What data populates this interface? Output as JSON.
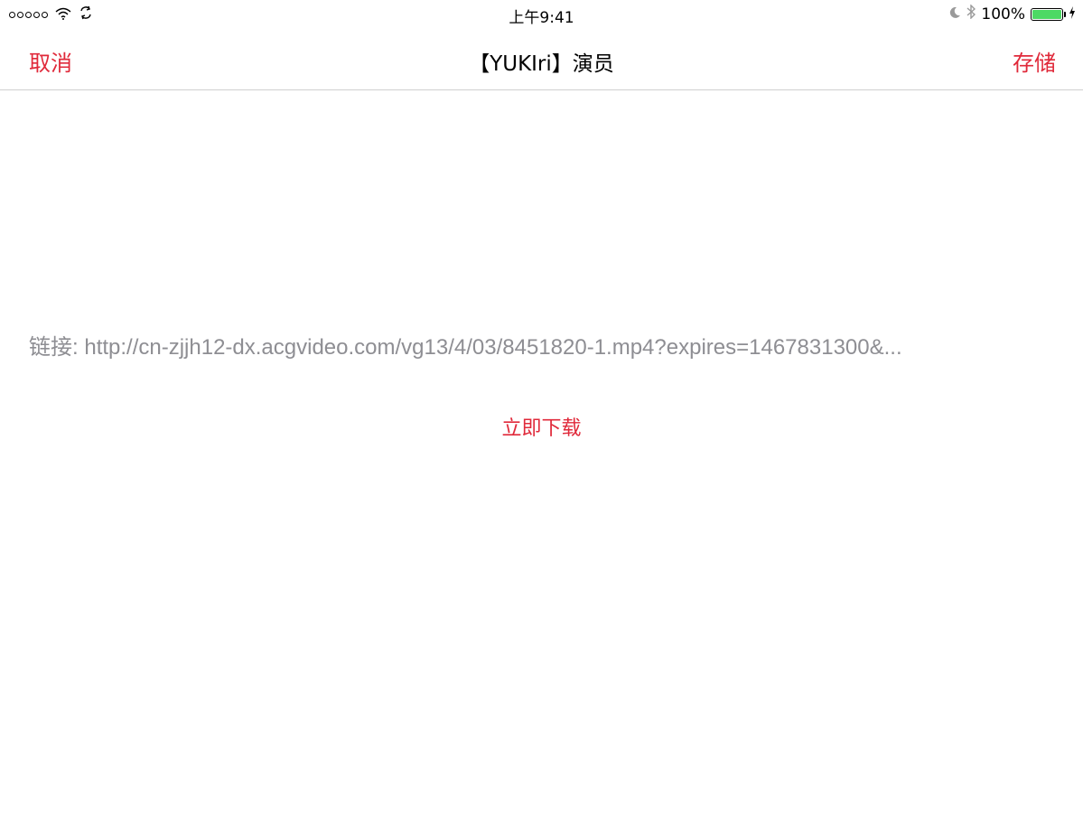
{
  "status_bar": {
    "time": "上午9:41",
    "battery_percent": "100%",
    "battery_level": 1.0,
    "battery_color": "#4cd964",
    "icons": [
      "signal-dots-icon",
      "wifi-icon",
      "sync-icon",
      "moon-icon",
      "bluetooth-icon",
      "battery-icon",
      "charging-icon"
    ]
  },
  "nav": {
    "cancel_label": "取消",
    "title": "【YUKIri】演员",
    "save_label": "存储"
  },
  "main": {
    "link_label": "链接:",
    "link_url": "http://cn-zjjh12-dx.acgvideo.com/vg13/4/03/8451820-1.mp4?expires=1467831300&...",
    "download_label": "立即下载"
  },
  "colors": {
    "accent": "#e0293a",
    "secondary_text": "#8e8e93"
  }
}
